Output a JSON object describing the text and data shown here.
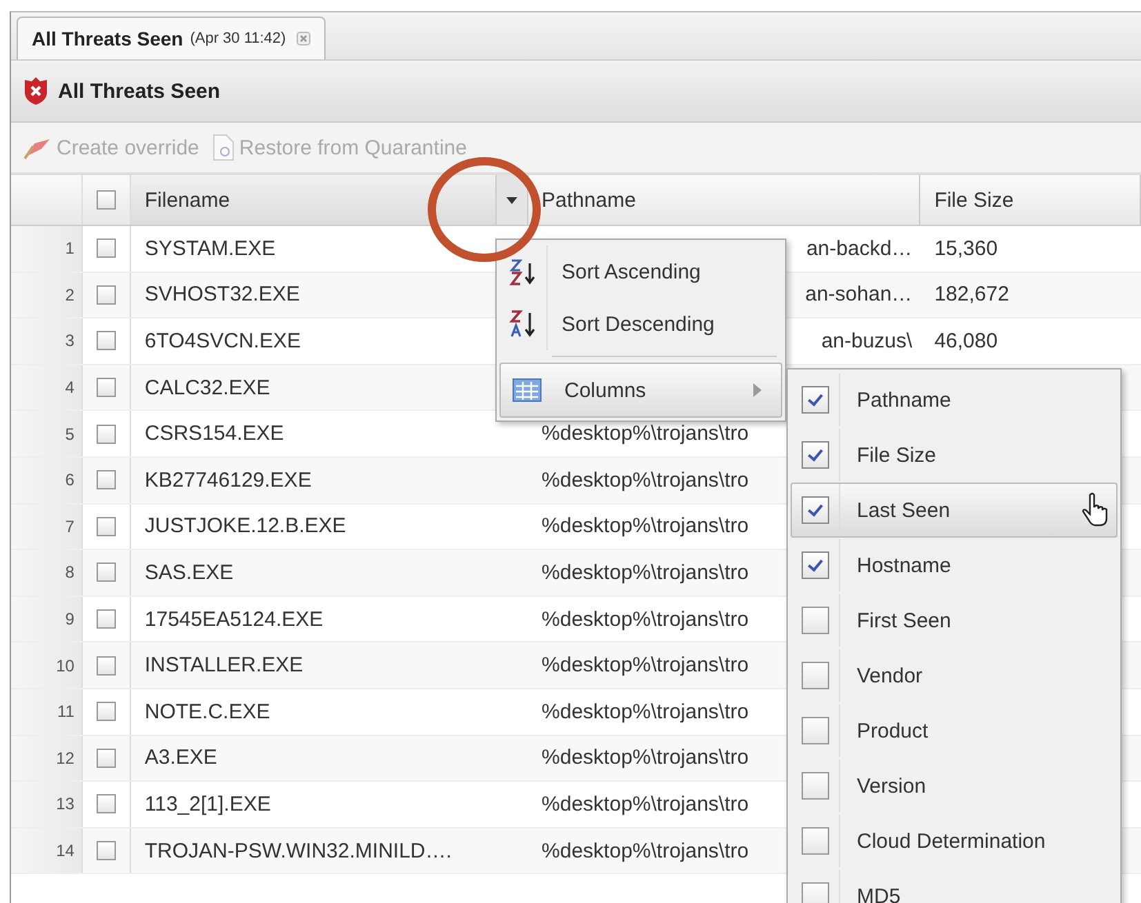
{
  "tab": {
    "title": "All Threats Seen",
    "timestamp": "(Apr 30 11:42)",
    "selected": true
  },
  "panel": {
    "title": "All Threats Seen"
  },
  "toolbar": [
    {
      "kind": "override",
      "label": "Create override",
      "disabled": true
    },
    {
      "kind": "restore",
      "label": "Restore from Quarantine",
      "disabled": true
    }
  ],
  "grid": {
    "select_all": {
      "checked": false
    },
    "columns": [
      {
        "label": "Filename",
        "menu_open": true
      },
      {
        "label": "Pathname",
        "menu_open": false
      },
      {
        "label": "File Size",
        "menu_open": false
      }
    ],
    "rows": [
      {
        "number": "1",
        "checked": false,
        "filename": "SYSTAM.EXE",
        "pathname": "an-backd…",
        "file_size": "15,360"
      },
      {
        "number": "2",
        "checked": false,
        "filename": "SVHOST32.EXE",
        "pathname": "an-sohan…",
        "file_size": "182,672"
      },
      {
        "number": "3",
        "checked": false,
        "filename": "6TO4SVCN.EXE",
        "pathname": "an-buzus\\",
        "file_size": "46,080"
      },
      {
        "number": "4",
        "checked": false,
        "filename": "CALC32.EXE"
      },
      {
        "number": "5",
        "checked": false,
        "filename": "CSRS154.EXE",
        "pathname": "%desktop%\\trojans\\tro"
      },
      {
        "number": "6",
        "checked": false,
        "filename": "KB27746129.EXE",
        "pathname": "%desktop%\\trojans\\tro"
      },
      {
        "number": "7",
        "checked": false,
        "filename": "JUSTJOKE.12.B.EXE",
        "pathname": "%desktop%\\trojans\\tro"
      },
      {
        "number": "8",
        "checked": false,
        "filename": "SAS.EXE",
        "pathname": "%desktop%\\trojans\\tro"
      },
      {
        "number": "9",
        "checked": false,
        "filename": "17545EA5124.EXE",
        "pathname": "%desktop%\\trojans\\tro"
      },
      {
        "number": "10",
        "checked": false,
        "filename": "INSTALLER.EXE",
        "pathname": "%desktop%\\trojans\\tro"
      },
      {
        "number": "11",
        "checked": false,
        "filename": "NOTE.C.EXE",
        "pathname": "%desktop%\\trojans\\tro"
      },
      {
        "number": "12",
        "checked": false,
        "filename": "A3.EXE",
        "pathname": "%desktop%\\trojans\\tro"
      },
      {
        "number": "13",
        "checked": false,
        "filename": "113_2[1].EXE",
        "pathname": "%desktop%\\trojans\\tro"
      },
      {
        "number": "14",
        "checked": false,
        "filename": "TROJAN-PSW.WIN32.MINILD….",
        "pathname": "%desktop%\\trojans\\tro"
      }
    ]
  },
  "column_menu": {
    "items": [
      {
        "kind": "sort-asc",
        "label": "Sort Ascending",
        "highlighted": false
      },
      {
        "kind": "sort-desc",
        "label": "Sort Descending",
        "highlighted": false
      },
      {
        "kind": "submenu",
        "label": "Columns",
        "highlighted": true
      }
    ]
  },
  "columns_submenu": {
    "items": [
      {
        "label": "Pathname",
        "checked": true,
        "highlighted": false
      },
      {
        "label": "File Size",
        "checked": true,
        "highlighted": false
      },
      {
        "label": "Last Seen",
        "checked": true,
        "highlighted": true
      },
      {
        "label": "Hostname",
        "checked": true,
        "highlighted": false
      },
      {
        "label": "First Seen",
        "checked": false,
        "highlighted": false
      },
      {
        "label": "Vendor",
        "checked": false,
        "highlighted": false
      },
      {
        "label": "Product",
        "checked": false,
        "highlighted": false
      },
      {
        "label": "Version",
        "checked": false,
        "highlighted": false
      },
      {
        "label": "Cloud Determination",
        "checked": false,
        "highlighted": false
      },
      {
        "label": "MD5",
        "checked": false,
        "highlighted": false
      }
    ]
  }
}
